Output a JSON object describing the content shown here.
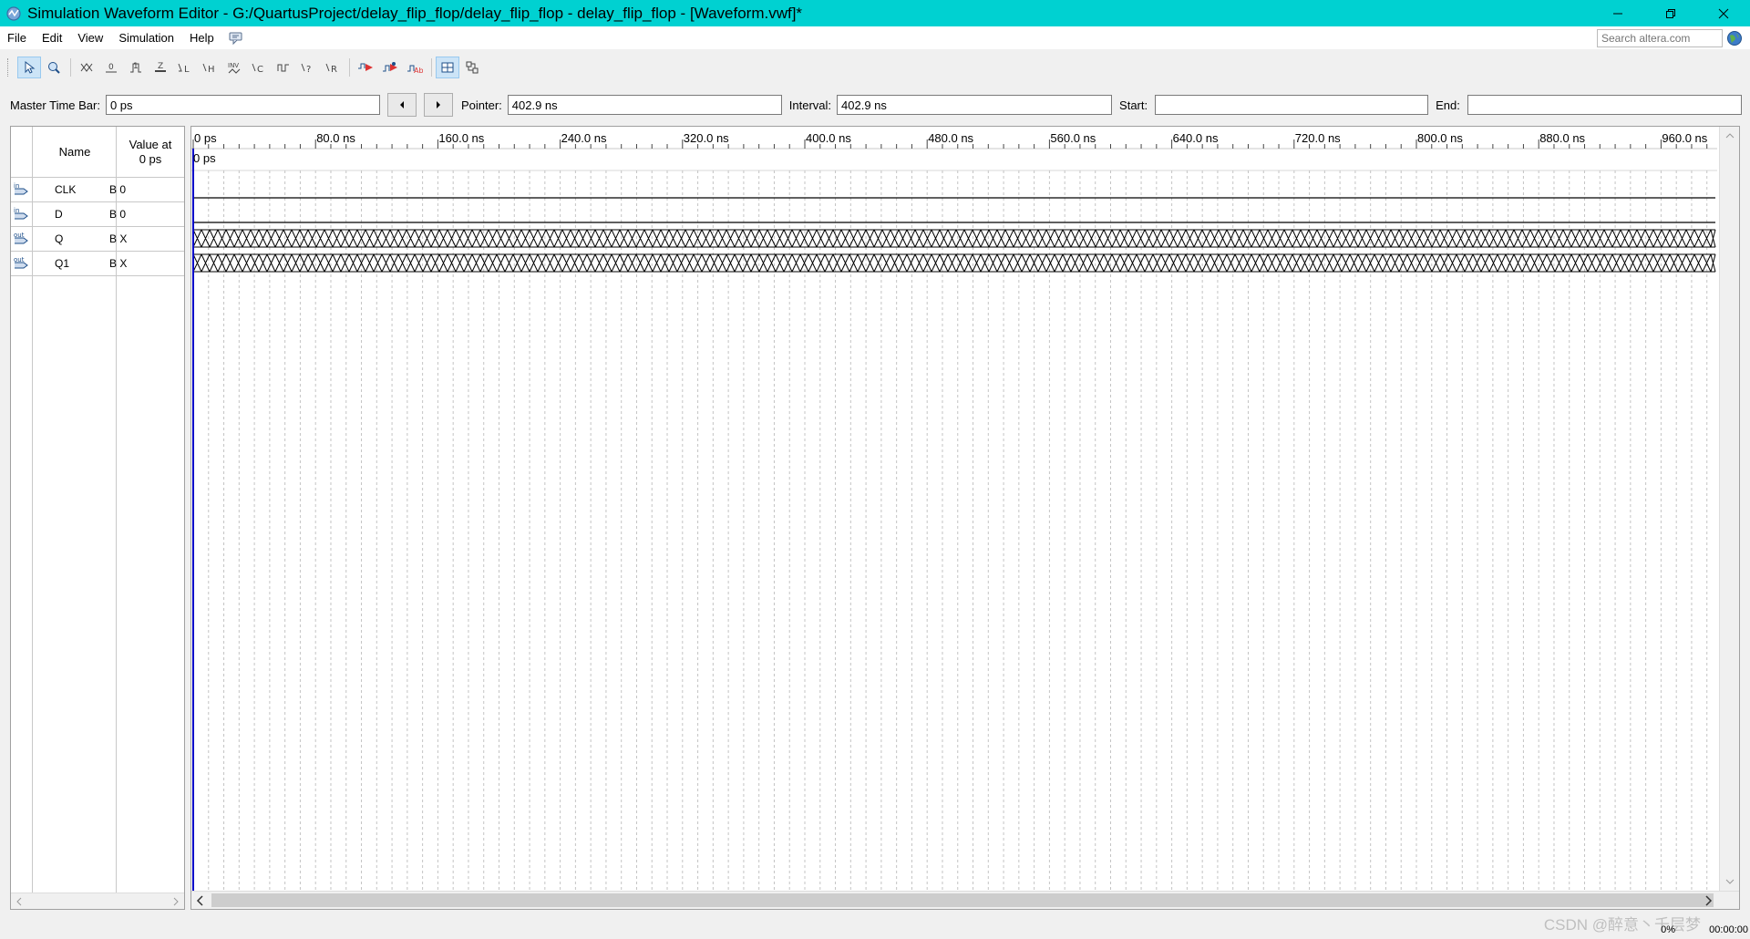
{
  "window": {
    "title": "Simulation Waveform Editor - G:/QuartusProject/delay_flip_flop/delay_flip_flop - delay_flip_flop - [Waveform.vwf]*"
  },
  "menu": {
    "file": "File",
    "edit": "Edit",
    "view": "View",
    "simulation": "Simulation",
    "help": "Help",
    "search_placeholder": "Search altera.com"
  },
  "timebar": {
    "master_label": "Master Time Bar:",
    "master_value": "0 ps",
    "pointer_label": "Pointer:",
    "pointer_value": "402.9 ns",
    "interval_label": "Interval:",
    "interval_value": "402.9 ns",
    "start_label": "Start:",
    "start_value": "",
    "end_label": "End:",
    "end_value": ""
  },
  "signal_table": {
    "col_name": "Name",
    "col_value_line1": "Value at",
    "col_value_line2": "0 ps",
    "signals": [
      {
        "name": "CLK",
        "value": "B 0",
        "direction": "in",
        "icon": "input-pin-icon"
      },
      {
        "name": "D",
        "value": "B 0",
        "direction": "in",
        "icon": "input-pin-icon"
      },
      {
        "name": "Q",
        "value": "B X",
        "direction": "out",
        "icon": "output-pin-icon"
      },
      {
        "name": "Q1",
        "value": "B X",
        "direction": "out",
        "icon": "output-pin-icon"
      }
    ]
  },
  "waveform": {
    "ruler_labels": [
      "0 ps",
      "80.0 ns",
      "160.0 ns",
      "240.0 ns",
      "320.0 ns",
      "400.0 ns",
      "480.0 ns",
      "560.0 ns",
      "640.0 ns",
      "720.0 ns",
      "800.0 ns",
      "880.0 ns",
      "960.0 ns"
    ],
    "cursor_label": "0 ps",
    "ruler_max_ns": 1000,
    "cursor_color": "#0000c8"
  },
  "status": {
    "percent": "0%",
    "elapsed": "00:00:00",
    "watermark": "CSDN @醉意丶千层梦"
  },
  "colors": {
    "titlebar": "#00d1d1"
  }
}
